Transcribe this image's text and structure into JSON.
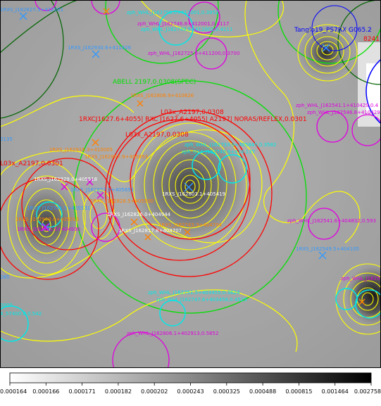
{
  "image_viewer": {
    "colors": {
      "yellow": "#ffff00",
      "red": "#ff0000",
      "green": "#00e000",
      "darkgreen": "#006400",
      "magenta": "#e000e0",
      "cyan": "#00e8e8",
      "blue": "#0000ff",
      "orange": "#ff8000",
      "lightblue": "#3399ff"
    },
    "labels": {
      "zph_top1": "zph_WHL_J162750.0+412001,0.3952",
      "zph_top2": "zph_WHL_J162746.8+412001,0.4117",
      "zph_top3": "zph_WHL_J162749.5+412001,0.4111",
      "zph_top4": "zph_WHL_J162725.6+411200,0.3700",
      "rxs_top": "1RXS_J162627.5+412001",
      "rxs_topleft": "1RXS_J162930.6+411826",
      "rxs_leftedge": "0135",
      "tanglo": "Tanglo19_PS7RX G065.2",
      "tanglo_val": "8241",
      "abell": "ABELL 2197,0.0308(SPEC)",
      "rxs_abell": "1RXS_J162806.9+410826",
      "main_red": "1RXCJ1627.6+4055| RXC J1627.6+4055| A2197| NORAS/REFLEX,0.0301",
      "l03x": "L03x_A2197,0.0308",
      "l03x_b": "L03x_A2197,0.0308",
      "l03x_left": "L03x_A2197,0.0301",
      "zph_right1": "zph_WHL_J162541.1+410429,0.4",
      "zph_right2": "zph_WHL_J162546.8+410429,0.4",
      "zph_center1": "zph_WHL_J162733.9+405845,0.3582",
      "zph_center2": "zph_G14_J162740.9+414.137",
      "rxs_c1": "1RXS_J162916.3+410005",
      "rxs_c2": "1RXS_J162857.9+405853",
      "rxs_c3": "1RXS_J162929.0+405518",
      "rxs_c4": "1RXS_J162857.9+405853",
      "rxs_c5": "1RXS_J162828.5+405500",
      "rxs_c6": "1RXS_J162741.5+405531",
      "rxs_c7": "1RXS_J162803.1+405419",
      "rxs_c8": "1RXS_J162826.0+404944",
      "rxs_c9": "1RXS_J162817.8+404707",
      "rxs_c10": "1RXS_J162743.3+404704",
      "rxs_left1": "1RXS_J162928.0+405013",
      "rxs_left2": "1RXS_J162921.5+404936",
      "zph_mid_right": "zph_WHL_J162541.6+404832,0.593",
      "rxs_mid_right": "1RXS_J162549.5+404105",
      "leftedge_285": "285",
      "zph_bottom1": "zph_WHL_J162751.5+403455,0.3624",
      "zph_bottom2": "zph_G14_J162747.6+403458,0.4525",
      "zph_right_bottom": "zph_WHL_J162547",
      "bottom_left": "4_57400.0,0.542",
      "bottom_left2": "0000",
      "zph_bottom3": "zph_WHL_J162806.1+402913,0.5852"
    },
    "colorbar": {
      "ticks": [
        "0.000164",
        "0.000166",
        "0.000171",
        "0.000182",
        "0.000202",
        "0.000243",
        "0.000325",
        "0.000488",
        "0.000815",
        "0.001464",
        "0.002758"
      ]
    }
  }
}
